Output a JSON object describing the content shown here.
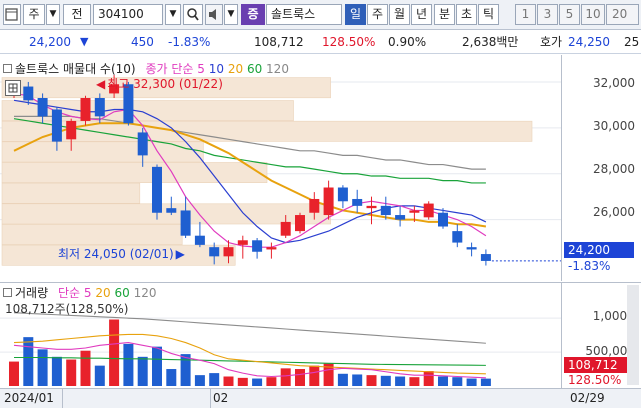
{
  "toolbar": {
    "icons": [
      "window-icon",
      "dropdown-icon"
    ],
    "market": "주",
    "prev": "전",
    "code": "304100",
    "name_badge": "증",
    "name": "솔트룩스",
    "periods": [
      "일",
      "주",
      "월",
      "년",
      "분",
      "초",
      "틱"
    ],
    "period_selected": "일",
    "intervals": [
      "1",
      "3",
      "5",
      "10",
      "20"
    ]
  },
  "quote": {
    "price": "24,200",
    "direction": "▼",
    "change": "450",
    "change_pct": "-1.83%",
    "volume": "108,712",
    "volume_ratio": "128.50%",
    "turnover_pct": "0.90%",
    "amount": "2,638백만",
    "ask_label": "호가",
    "ask": "24,250",
    "next": "25"
  },
  "price_panel": {
    "legend_name": "솔트룩스",
    "legend_suffix": "매물대 수(10)",
    "legend_ma": "종가 단순",
    "ma_periods": [
      "5",
      "10",
      "20",
      "60",
      "120"
    ],
    "ma_colors": [
      "#e03bbf",
      "#2b3fd0",
      "#e8a20e",
      "#19a33a",
      "#888888"
    ],
    "high_label": "최고 32,300 (01/22)",
    "low_label": "최저 24,050 (02/01)",
    "yticks": [
      "32,000",
      "30,000",
      "28,000",
      "26,000"
    ],
    "price_tag": "24,200",
    "pct_tag": "-1.83%"
  },
  "volume_panel": {
    "legend_label": "거래량",
    "legend_ma": "단순",
    "ma_periods": [
      "5",
      "20",
      "60",
      "120"
    ],
    "value_label": "108,712주(128,50%)",
    "yticks": [
      "1,000K",
      "500,000"
    ],
    "volume_tag": "108,712",
    "pct_tag": "128.50%"
  },
  "xaxis": {
    "labels": [
      "2024/01",
      "02",
      "02/29"
    ]
  },
  "chart_data": {
    "type": "candlestick",
    "ylim": [
      23500,
      33000
    ],
    "candles": [
      {
        "o": 31700,
        "h": 32000,
        "l": 31300,
        "c": 31800
      },
      {
        "o": 31800,
        "h": 32000,
        "l": 31000,
        "c": 31200
      },
      {
        "o": 31300,
        "h": 31500,
        "l": 30200,
        "c": 30500
      },
      {
        "o": 30800,
        "h": 30900,
        "l": 29000,
        "c": 29400
      },
      {
        "o": 29500,
        "h": 30400,
        "l": 29000,
        "c": 30300
      },
      {
        "o": 30300,
        "h": 31400,
        "l": 30100,
        "c": 31300
      },
      {
        "o": 31300,
        "h": 31500,
        "l": 30200,
        "c": 30500
      },
      {
        "o": 31500,
        "h": 32300,
        "l": 31300,
        "c": 31900
      },
      {
        "o": 31900,
        "h": 32000,
        "l": 30100,
        "c": 30200
      },
      {
        "o": 29800,
        "h": 30000,
        "l": 28300,
        "c": 28800
      },
      {
        "o": 28300,
        "h": 28400,
        "l": 26000,
        "c": 26300
      },
      {
        "o": 26500,
        "h": 27000,
        "l": 26200,
        "c": 26300
      },
      {
        "o": 26400,
        "h": 27000,
        "l": 25200,
        "c": 25300
      },
      {
        "o": 25300,
        "h": 25900,
        "l": 24800,
        "c": 24900
      },
      {
        "o": 24800,
        "h": 25000,
        "l": 24050,
        "c": 24400
      },
      {
        "o": 24400,
        "h": 25100,
        "l": 24100,
        "c": 24800
      },
      {
        "o": 24900,
        "h": 25300,
        "l": 24300,
        "c": 25100
      },
      {
        "o": 25100,
        "h": 25200,
        "l": 24300,
        "c": 24600
      },
      {
        "o": 24700,
        "h": 25000,
        "l": 24300,
        "c": 24800
      },
      {
        "o": 25300,
        "h": 26200,
        "l": 25200,
        "c": 25900
      },
      {
        "o": 25500,
        "h": 26300,
        "l": 25400,
        "c": 26200
      },
      {
        "o": 26300,
        "h": 27200,
        "l": 26000,
        "c": 26900
      },
      {
        "o": 26200,
        "h": 27700,
        "l": 26000,
        "c": 27400
      },
      {
        "o": 27400,
        "h": 27500,
        "l": 26500,
        "c": 26800
      },
      {
        "o": 26900,
        "h": 27300,
        "l": 26300,
        "c": 26600
      },
      {
        "o": 26500,
        "h": 27000,
        "l": 25800,
        "c": 26600
      },
      {
        "o": 26600,
        "h": 27000,
        "l": 26000,
        "c": 26200
      },
      {
        "o": 26200,
        "h": 26600,
        "l": 25700,
        "c": 26000
      },
      {
        "o": 26300,
        "h": 26600,
        "l": 25900,
        "c": 26400
      },
      {
        "o": 26100,
        "h": 26800,
        "l": 26000,
        "c": 26700
      },
      {
        "o": 26300,
        "h": 26500,
        "l": 25600,
        "c": 25700
      },
      {
        "o": 25500,
        "h": 25800,
        "l": 24800,
        "c": 25000
      },
      {
        "o": 24800,
        "h": 25000,
        "l": 24400,
        "c": 24700
      },
      {
        "o": 24500,
        "h": 24700,
        "l": 24000,
        "c": 24200
      }
    ],
    "volume_ylim": [
      0,
      1400000
    ],
    "volumes": [
      360000,
      720000,
      540000,
      430000,
      390000,
      520000,
      300000,
      980000,
      620000,
      430000,
      580000,
      250000,
      470000,
      160000,
      190000,
      140000,
      120000,
      110000,
      130000,
      260000,
      250000,
      300000,
      330000,
      180000,
      170000,
      160000,
      150000,
      140000,
      130000,
      220000,
      140000,
      130000,
      110000,
      108712
    ],
    "ma5": [
      31500,
      31400,
      31000,
      30700,
      30500,
      30400,
      30350,
      30700,
      30800,
      30100,
      29000,
      28100,
      27000,
      26200,
      25500,
      25000,
      24850,
      24800,
      24800,
      25000,
      25300,
      25700,
      26100,
      26400,
      26700,
      26800,
      26700,
      26600,
      26400,
      26400,
      26200,
      26000,
      25700,
      25300
    ],
    "ma10": [
      31200,
      31100,
      31000,
      30900,
      30800,
      30700,
      30700,
      30800,
      30800,
      30700,
      30400,
      30000,
      29400,
      28700,
      27900,
      27100,
      26300,
      25700,
      25200,
      25000,
      25100,
      25300,
      25500,
      25800,
      26100,
      26300,
      26500,
      26600,
      26600,
      26500,
      26400,
      26300,
      26200,
      25900
    ],
    "ma20": [
      29000,
      29300,
      29600,
      29800,
      30000,
      30100,
      30200,
      30200,
      30200,
      30100,
      30000,
      29900,
      29700,
      29500,
      29200,
      28900,
      28500,
      28100,
      27700,
      27400,
      27100,
      26800,
      26600,
      26400,
      26300,
      26200,
      26100,
      26000,
      26000,
      25900,
      25900,
      25800,
      25800,
      25700
    ],
    "ma60": [
      30400,
      30300,
      30200,
      30100,
      30000,
      29900,
      29800,
      29700,
      29600,
      29500,
      29400,
      29300,
      29100,
      29000,
      28800,
      28700,
      28600,
      28500,
      28400,
      28300,
      28300,
      28200,
      28100,
      28000,
      28000,
      27900,
      27900,
      27800,
      27800,
      27800,
      27700,
      27700,
      27600,
      27600
    ],
    "ma120": [
      30500,
      30500,
      30500,
      30500,
      30500,
      30400,
      30400,
      30300,
      30200,
      30100,
      30000,
      29900,
      29800,
      29700,
      29600,
      29500,
      29400,
      29300,
      29200,
      29100,
      29000,
      29000,
      28900,
      28800,
      28800,
      28700,
      28600,
      28600,
      28500,
      28400,
      28400,
      28300,
      28200,
      28200
    ],
    "volume_ma5": [
      600000,
      580000,
      560000,
      540000,
      540000,
      560000,
      600000,
      620000,
      640000,
      600000,
      560000,
      480000,
      420000,
      380000,
      330000,
      240000,
      190000,
      150000,
      140000,
      150000,
      170000,
      200000,
      240000,
      260000,
      250000,
      240000,
      210000,
      180000,
      160000,
      160000,
      150000,
      140000,
      130000,
      120000
    ],
    "volume_ma20": [
      640000,
      650000,
      660000,
      680000,
      700000,
      720000,
      740000,
      750000,
      760000,
      760000,
      740000,
      700000,
      640000,
      560000,
      460000,
      400000,
      380000,
      360000,
      340000,
      320000,
      300000,
      290000,
      280000,
      270000,
      260000,
      250000,
      240000,
      230000,
      220000,
      210000,
      200000,
      190000,
      185000,
      180000
    ],
    "volume_ma60": [
      420000,
      420000,
      420000,
      415000,
      415000,
      410000,
      410000,
      405000,
      400000,
      400000,
      395000,
      390000,
      385000,
      380000,
      375000,
      370000,
      365000,
      360000,
      355000,
      350000,
      345000,
      340000,
      335000,
      330000,
      325000,
      320000,
      318000,
      316000,
      314000,
      312000,
      310000,
      308000,
      306000,
      304000
    ],
    "volume_ma120": [
      1080000,
      1070000,
      1060000,
      1050000,
      1040000,
      1030000,
      1020000,
      1010000,
      1000000,
      990000,
      975000,
      960000,
      945000,
      930000,
      915000,
      900000,
      885000,
      870000,
      855000,
      840000,
      825000,
      810000,
      795000,
      780000,
      765000,
      750000,
      735000,
      720000,
      705000,
      690000,
      675000,
      660000,
      645000,
      630000
    ],
    "volume_profile": [
      {
        "price": 31750,
        "weight": 0.62
      },
      {
        "price": 30750,
        "weight": 0.55
      },
      {
        "price": 29850,
        "weight": 1.0
      },
      {
        "price": 28950,
        "weight": 0.38
      },
      {
        "price": 28050,
        "weight": 0.5
      },
      {
        "price": 27150,
        "weight": 0.26
      },
      {
        "price": 26250,
        "weight": 0.62
      },
      {
        "price": 25350,
        "weight": 0.34
      },
      {
        "price": 24450,
        "weight": 0.44
      }
    ],
    "colors": {
      "up": "#e8222b",
      "down": "#1f5fd0"
    }
  }
}
